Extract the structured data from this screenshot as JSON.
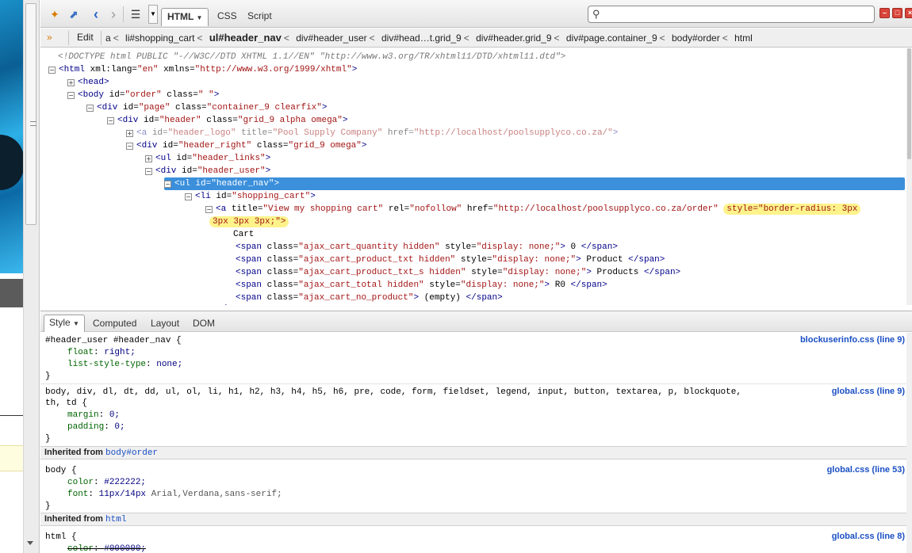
{
  "toolbar": {
    "tabs": [
      "HTML",
      "CSS",
      "Script"
    ],
    "search_placeholder": ""
  },
  "breadcrumb": {
    "edit_label": "Edit",
    "items": [
      "a",
      "li#shopping_cart",
      "ul#header_nav",
      "div#header_user",
      "div#head…t.grid_9",
      "div#header.grid_9",
      "div#page.container_9",
      "body#order",
      "html"
    ],
    "separator": "<"
  },
  "tree": {
    "doctype": "<!DOCTYPE html PUBLIC \"-//W3C//DTD XHTML 1.1//EN\" \"http://www.w3.org/TR/xhtml11/DTD/xhtml11.dtd\">",
    "html_attrs": {
      "xml_lang": "\"en\"",
      "xmlns": "\"http://www.w3.org/1999/xhtml\""
    },
    "body_attrs": {
      "id": "\"order\"",
      "class": "\" \""
    },
    "div_page": {
      "id": "\"page\"",
      "class": "\"container_9 clearfix\""
    },
    "div_header": {
      "id": "\"header\"",
      "class": "\"grid_9 alpha omega\""
    },
    "a_logo": {
      "id": "\"header_logo\"",
      "title": "\"Pool Supply Company\"",
      "href": "\"http://localhost/poolsupplyco.co.za/\""
    },
    "div_header_right": {
      "id": "\"header_right\"",
      "class": "\"grid_9 omega\""
    },
    "ul_links": {
      "id": "\"header_links\""
    },
    "div_user": {
      "id": "\"header_user\""
    },
    "ul_nav": {
      "id": "\"header_nav\""
    },
    "li_cart": {
      "id": "\"shopping_cart\""
    },
    "a_cart": {
      "title": "\"View my shopping cart\"",
      "rel": "\"nofollow\"",
      "href": "\"http://localhost/poolsupplyco.co.za/order\"",
      "style_1": "style=\"border-radius: 3px",
      "style_2": "3px 3px 3px;\">"
    },
    "cart_text": "Cart",
    "spans": [
      {
        "class": "\"ajax_cart_quantity hidden\"",
        "style": "\"display: none;\"",
        "text": "0"
      },
      {
        "class": "\"ajax_cart_product_txt hidden\"",
        "style": "\"display: none;\"",
        "text": "Product"
      },
      {
        "class": "\"ajax_cart_product_txt_s hidden\"",
        "style": "\"display: none;\"",
        "text": "Products"
      },
      {
        "class": "\"ajax_cart_total hidden\"",
        "style": "\"display: none;\"",
        "text": "R0"
      },
      {
        "class": "\"ajax_cart_no_product\"",
        "style": "",
        "text": "(empty)"
      }
    ]
  },
  "side_tabs": [
    "Style",
    "Computed",
    "Layout",
    "DOM"
  ],
  "rules": [
    {
      "selector": "#header_user #header_nav {",
      "source": "blockuserinfo.css (line 9)",
      "props": [
        {
          "name": "float",
          "value": "right;"
        },
        {
          "name": "list-style-type",
          "value": "none;"
        }
      ]
    },
    {
      "selector_1": "body, div, dl, dt, dd, ul, ol, li, h1, h2, h3, h4, h5, h6, pre, code, form, fieldset, legend, input, button, textarea, p, blockquote,",
      "selector_2": "th, td {",
      "source": "global.css (line 9)",
      "props": [
        {
          "name": "margin",
          "value": "0;"
        },
        {
          "name": "padding",
          "value": "0;"
        }
      ]
    },
    {
      "inherited_label": "Inherited from",
      "inherited_ref": "body#order",
      "selector": "body {",
      "source": "global.css (line 53)",
      "props": [
        {
          "name": "color",
          "value": "#222222;"
        },
        {
          "name": "font",
          "value": "11px/14px",
          "value_rest": "Arial,Verdana,sans-serif;"
        }
      ]
    },
    {
      "inherited_label": "Inherited from",
      "inherited_ref": "html",
      "selector": "html {",
      "source": "global.css (line 8)",
      "props": [
        {
          "name": "color",
          "value": "#000000;"
        }
      ]
    }
  ],
  "close_brace": "}"
}
